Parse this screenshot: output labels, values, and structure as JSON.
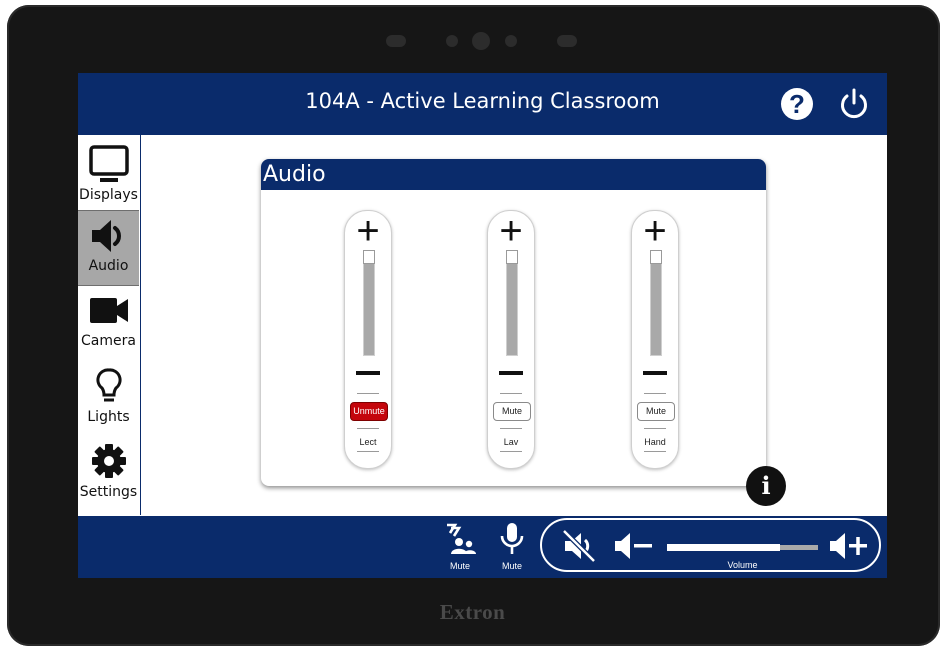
{
  "header": {
    "title": "104A - Active Learning Classroom"
  },
  "sidebar": {
    "items": [
      {
        "label": "Displays",
        "icon": "monitor-icon",
        "active": false
      },
      {
        "label": "Audio",
        "icon": "speaker-icon",
        "active": true
      },
      {
        "label": "Camera",
        "icon": "video-camera-icon",
        "active": false
      },
      {
        "label": "Lights",
        "icon": "lightbulb-icon",
        "active": false
      },
      {
        "label": "Settings",
        "icon": "gear-icon",
        "active": false
      }
    ]
  },
  "audio": {
    "title": "Audio",
    "channels": [
      {
        "name": "Lect",
        "mute_label": "Unmute",
        "muted": true,
        "level": 1.0
      },
      {
        "name": "Lav",
        "mute_label": "Mute",
        "muted": false,
        "level": 1.0
      },
      {
        "name": "Hand",
        "mute_label": "Mute",
        "muted": false,
        "level": 1.0
      }
    ]
  },
  "footer": {
    "mic_group_mute": {
      "label": "Mute",
      "icon": "wireless-mic-group-icon"
    },
    "mic_mute": {
      "label": "Mute",
      "icon": "microphone-icon"
    },
    "volume": {
      "label": "Volume",
      "level": 0.75,
      "mute_icon": "speaker-muted-icon",
      "down_icon": "volume-down-icon",
      "up_icon": "volume-up-icon"
    }
  },
  "device": {
    "brand": "Extron"
  },
  "colors": {
    "primary": "#0a2b6b",
    "mute_active": "#c4060c",
    "active_tab": "#a7a7a7"
  }
}
